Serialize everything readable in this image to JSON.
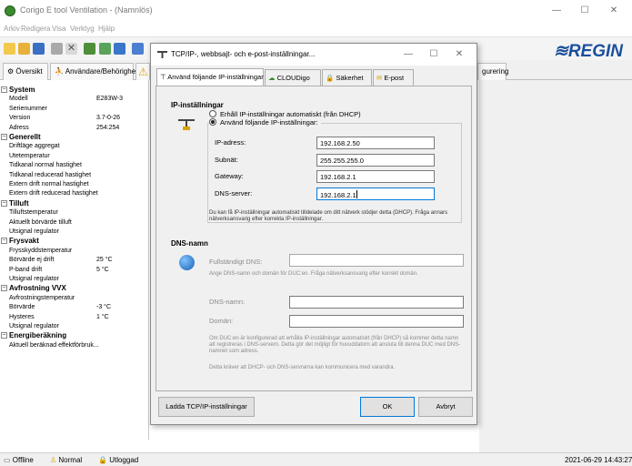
{
  "app": {
    "title": "Corigo E tool Ventilation - (Namnlös)",
    "menu": [
      "Arkiv",
      "Redigera",
      "Visa",
      "Verktyg",
      "Hjälp"
    ],
    "logo": "≋REGIN",
    "tabs": [
      "Översikt",
      "Användare/Behörighet",
      "gurering"
    ],
    "window_controls": {
      "minimize": "—",
      "maximize": "☐",
      "close": "✕"
    }
  },
  "tree": [
    {
      "type": "group",
      "expander": "−",
      "label": "System"
    },
    {
      "type": "item",
      "label": "Modell",
      "value": "E283W-3"
    },
    {
      "type": "item",
      "label": "Serienummer",
      "value": ""
    },
    {
      "type": "item",
      "label": "Version",
      "value": "3.7-0-26"
    },
    {
      "type": "item",
      "label": "Adress",
      "value": "254:254"
    },
    {
      "type": "group",
      "expander": "−",
      "label": "Generellt"
    },
    {
      "type": "item",
      "label": "Driftläge aggregat",
      "value": ""
    },
    {
      "type": "item",
      "label": "Utetemperatur",
      "value": ""
    },
    {
      "type": "item",
      "label": "Tidkanal normal hastighet",
      "value": ""
    },
    {
      "type": "item",
      "label": "Tidkanal reducerad hastighet",
      "value": ""
    },
    {
      "type": "item",
      "label": "Extern drift normal hastighet",
      "value": ""
    },
    {
      "type": "item",
      "label": "Extern drift reducerad hastighet",
      "value": ""
    },
    {
      "type": "group",
      "expander": "−",
      "label": "Tilluft"
    },
    {
      "type": "item",
      "label": "Tilluftstemperatur",
      "value": ""
    },
    {
      "type": "item",
      "label": "Aktuellt börvärde tilluft",
      "value": ""
    },
    {
      "type": "item",
      "label": "Utsignal regulator",
      "value": ""
    },
    {
      "type": "group",
      "expander": "−",
      "label": "Frysvakt"
    },
    {
      "type": "item",
      "label": "Frysskyddstemperatur",
      "value": ""
    },
    {
      "type": "item",
      "label": "Börvärde ej drift",
      "value": "25 °C"
    },
    {
      "type": "item",
      "label": "P-band drift",
      "value": "5 °C"
    },
    {
      "type": "item",
      "label": "Utsignal regulator",
      "value": ""
    },
    {
      "type": "group",
      "expander": "−",
      "label": "Avfrostning VVX"
    },
    {
      "type": "item",
      "label": "Avfrostningstemperatur",
      "value": ""
    },
    {
      "type": "item",
      "label": "Börvärde",
      "value": "-3 °C"
    },
    {
      "type": "item",
      "label": "Hysteres",
      "value": "1 °C"
    },
    {
      "type": "item",
      "label": "Utsignal regulator",
      "value": ""
    },
    {
      "type": "group",
      "expander": "−",
      "label": "Energiberäkning"
    },
    {
      "type": "item",
      "label": "Aktuell beräknad effektförbruk...",
      "value": ""
    }
  ],
  "status": {
    "offline": "Offline",
    "mode": "Normal",
    "login": "Utloggad",
    "datetime": "2021-06-29 14:43:27"
  },
  "dialog": {
    "title": "TCP/IP-, webbsajt- och e-post-inställningar...",
    "tabs": [
      "Använd följande IP-inställningar",
      "CLOUDigo",
      "Säkerhet",
      "E-post"
    ],
    "ip_section_title": "IP-inställningar",
    "radio_dhcp": "Erhåll IP-inställningar automatiskt (från DHCP)",
    "radio_static": "Använd följande IP-inställningar:",
    "fields": [
      {
        "label": "IP-adress:",
        "value": "192.168.2.50"
      },
      {
        "label": "Subnät:",
        "value": "255.255.255.0"
      },
      {
        "label": "Gateway:",
        "value": "192.168.2.1"
      },
      {
        "label": "DNS-server:",
        "value": "192.168.2.1"
      }
    ],
    "ip_info": "Du kan få IP-inställningar automatiskt tilldelade om ditt nätverk stödjer detta (DHCP). Fråga annars nätverksansvarig efter korrekta IP-inställningar.",
    "dns_section_title": "DNS-namn",
    "fqdn_label": "Fullständigt DNS:",
    "fqdn_value": "",
    "dns_info": "Ange DNS-namn och domän för DUC:en. Fråga nätverksansvarig efter korrekt domän.",
    "dns_name_label": "DNS-namn:",
    "dns_name_value": "",
    "domain_label": "Domän:",
    "domain_value": "",
    "dhcp_info": "Om DUC:en är konfigurerad att erhålla IP-inställningar automatiskt (från DHCP) så kommer detta namn att registreras i DNS-servern. Detta gör det möjligt för huvuddatorn att ansluta till denna DUC med DNS-namnet som adress.",
    "requirement_info": "Detta kräver att DHCP- och DNS-servrarna kan kommunicera med varandra.",
    "load_button": "Ladda TCP/IP-inställningar",
    "ok_button": "OK",
    "cancel_button": "Avbryt",
    "window_controls": {
      "minimize": "—",
      "maximize": "☐",
      "close": "✕"
    }
  }
}
